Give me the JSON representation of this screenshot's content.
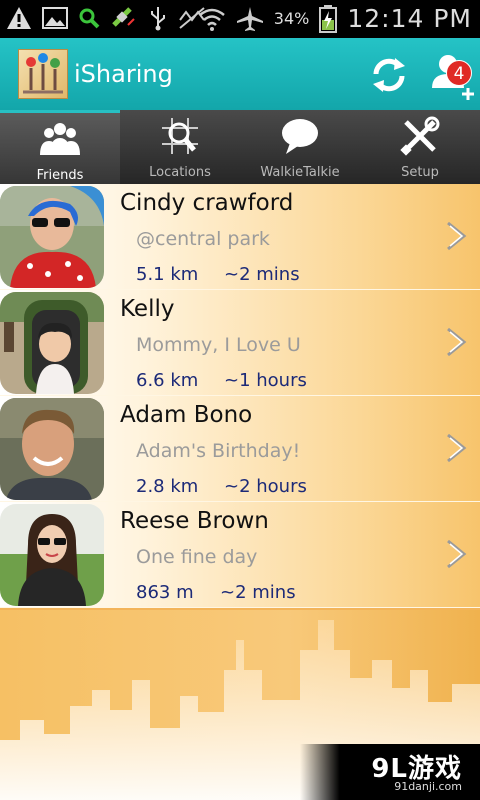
{
  "status_bar": {
    "battery_percent": "34%",
    "time": "12:14 PM",
    "icons": [
      "warning-icon",
      "image-icon",
      "search-icon",
      "satellite-icon",
      "usb-icon",
      "no-signal-icon",
      "wifi-icon",
      "airplane-icon",
      "battery-charging-icon"
    ]
  },
  "header": {
    "app_title": "iSharing",
    "friend_requests_badge": "4",
    "accent_color": "#13a6aa"
  },
  "tabs": [
    {
      "label": "Friends",
      "icon": "friends-icon",
      "active": true
    },
    {
      "label": "Locations",
      "icon": "map-search-icon",
      "active": false
    },
    {
      "label": "WalkieTalkie",
      "icon": "speech-bubble-icon",
      "active": false
    },
    {
      "label": "Setup",
      "icon": "tools-icon",
      "active": false
    }
  ],
  "friends": [
    {
      "name": "Cindy crawford",
      "status": "@central park",
      "distance": "5.1 km",
      "eta": "~2 mins"
    },
    {
      "name": "Kelly",
      "status": "Mommy, I Love U",
      "distance": "6.6 km",
      "eta": "~1 hours"
    },
    {
      "name": "Adam Bono",
      "status": "Adam's Birthday!",
      "distance": "2.8 km",
      "eta": "~2 hours"
    },
    {
      "name": "Reese Brown",
      "status": "One fine day",
      "distance": "863 m",
      "eta": "~2 mins"
    }
  ],
  "watermark": {
    "logo": "9L游戏",
    "url": "91danji.com"
  }
}
